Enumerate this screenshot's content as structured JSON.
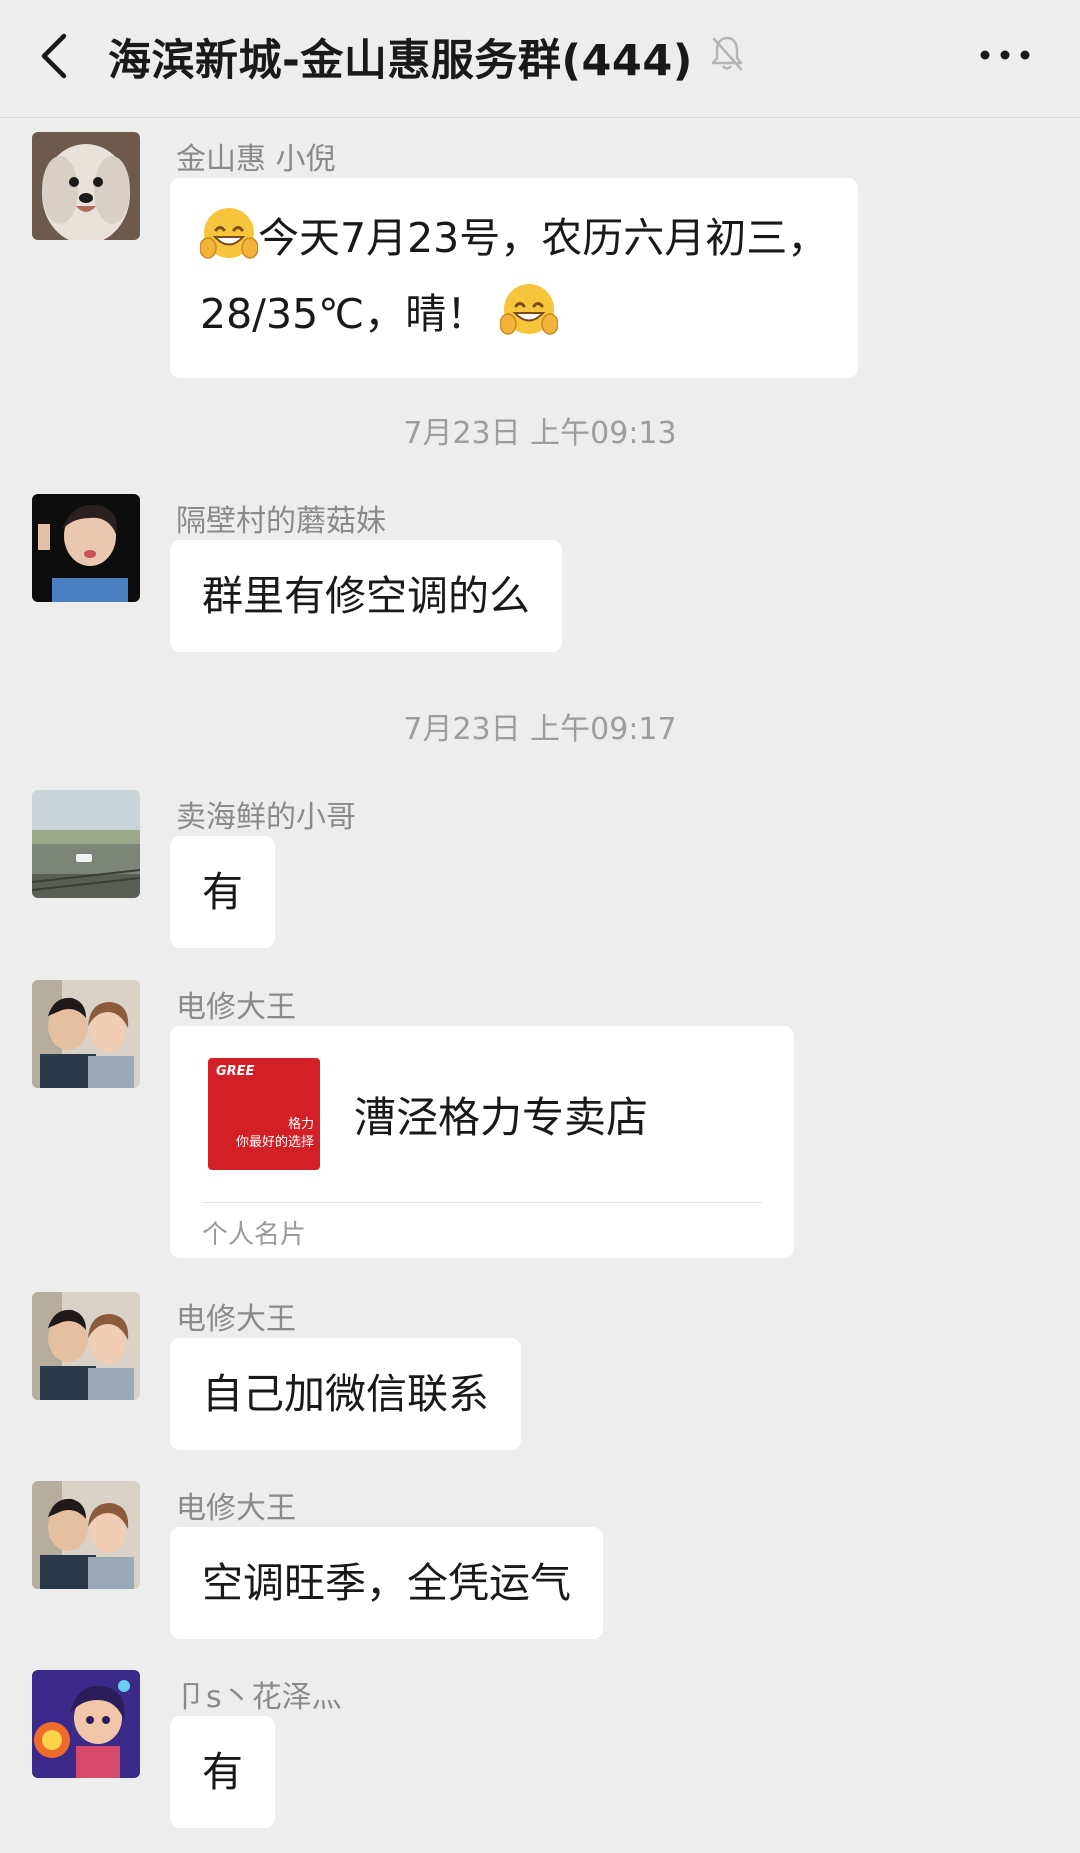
{
  "header": {
    "title": "海滨新城-金山惠服务群(444)"
  },
  "messages": [
    {
      "sender": "金山惠 小倪",
      "text_line1": "今天7月23号，农历六月初三，",
      "text_line2": "28/35℃，晴！"
    },
    {
      "timestamp": "7月23日 上午09:13"
    },
    {
      "sender": "隔壁村的蘑菇妹",
      "text": "群里有修空调的么"
    },
    {
      "timestamp": "7月23日 上午09:17"
    },
    {
      "sender": "卖海鲜的小哥",
      "text": "有"
    },
    {
      "sender": "电修大王",
      "card": {
        "name": "漕泾格力专卖店",
        "type": "个人名片",
        "logo_brand": "GREE",
        "logo_tagline1": "格力",
        "logo_tagline2": "你最好的选择"
      }
    },
    {
      "sender": "电修大王",
      "text": "自己加微信联系"
    },
    {
      "sender": "电修大王",
      "text": "空调旺季，全凭运气"
    },
    {
      "sender": "卩s丶花泽灬",
      "text": "有"
    }
  ],
  "colors": {
    "background": "#ededed",
    "bubble": "#ffffff",
    "sender_text": "#8a8a8a",
    "timestamp_text": "#9d9d9d",
    "card_logo": "#d32027"
  }
}
